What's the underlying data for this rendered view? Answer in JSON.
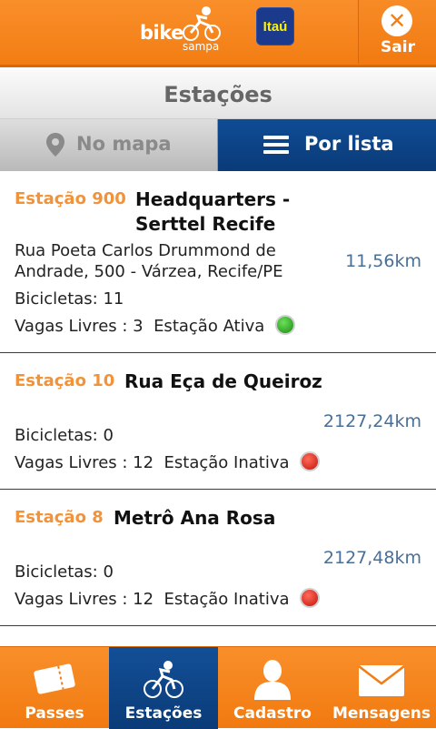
{
  "header": {
    "logo_bike": "bike",
    "logo_sampa": "sampa",
    "sponsor": "Itaú",
    "exit_label": "Sair"
  },
  "page_title": "Estações",
  "view_toggle": {
    "map_label": "No mapa",
    "list_label": "Por lista",
    "active": "list"
  },
  "stations": [
    {
      "code": "Estação 900",
      "name_line1": "Headquarters -",
      "name_line2": "Serttel Recife",
      "address_line1": "Rua Poeta Carlos Drummond de",
      "address_line2": "Andrade, 500 - Várzea, Recife/PE",
      "bikes": "Bicicletas: 11",
      "free_slots": "Vagas Livres : 3",
      "status": "Estação Ativa",
      "status_color": "#1a8a12",
      "distance": "11,56km"
    },
    {
      "code": "Estação 10",
      "name_line1": "Rua Eça de Queiroz",
      "bikes": "Bicicletas: 0",
      "free_slots": "Vagas Livres : 12",
      "status": "Estação Inativa",
      "status_color": "#c4120a",
      "distance": "2127,24km"
    },
    {
      "code": "Estação 8",
      "name_line1": "Metrô Ana Rosa",
      "bikes": "Bicicletas: 0",
      "free_slots": "Vagas Livres : 12",
      "status": "Estação Inativa",
      "status_color": "#c4120a",
      "distance": "2127,48km"
    }
  ],
  "bottom_nav": [
    {
      "label": "Passes",
      "icon": "ticket-icon",
      "active": false
    },
    {
      "label": "Estações",
      "icon": "bike-icon",
      "active": true
    },
    {
      "label": "Cadastro",
      "icon": "user-icon",
      "active": false
    },
    {
      "label": "Mensagens",
      "icon": "envelope-icon",
      "active": false
    }
  ],
  "colors": {
    "brand_orange": "#f37d14",
    "brand_blue": "#0a3b78",
    "code_orange": "#f0933a",
    "distance_blue": "#4a6f96"
  }
}
